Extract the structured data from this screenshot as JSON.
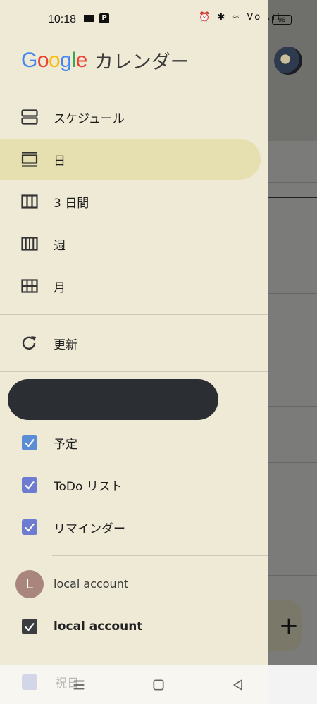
{
  "status_bar": {
    "time": "10:18",
    "battery": "96",
    "indicators": "⏰ ✱ ≈ Vo .ıl"
  },
  "app": {
    "logo_text": "Google",
    "name": "カレンダー"
  },
  "nav": {
    "items": [
      {
        "label": "スケジュール",
        "icon": "schedule-icon"
      },
      {
        "label": "日",
        "icon": "day-icon"
      },
      {
        "label": "3 日間",
        "icon": "three-day-icon"
      },
      {
        "label": "週",
        "icon": "week-icon"
      },
      {
        "label": "月",
        "icon": "month-icon"
      }
    ],
    "refresh_label": "更新"
  },
  "calendars": {
    "items": [
      {
        "label": "予定",
        "color": "#5b8dd6"
      },
      {
        "label": "ToDo リスト",
        "color": "#6d7bd0"
      },
      {
        "label": "リマインダー",
        "color": "#6d7bd0"
      }
    ]
  },
  "local_account": {
    "avatar_letter": "L",
    "header": "local account",
    "calendar_label": "local account",
    "calendar_color": "#3b3d40",
    "partial_item_label": "祝日"
  },
  "colors": {
    "drawer_bg": "#eeead6",
    "active_item_bg": "#e6e0b0"
  }
}
